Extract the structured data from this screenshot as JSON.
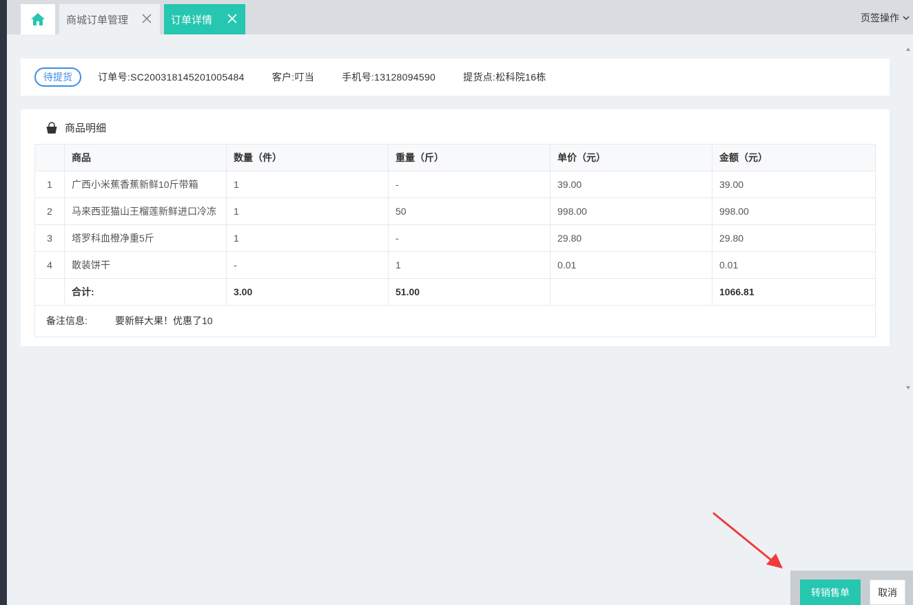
{
  "tabs": {
    "home_icon": "home-icon",
    "mall_orders": "商城订单管理",
    "order_detail": "订单详情",
    "page_ops": "页签操作"
  },
  "order": {
    "status": "待提货",
    "order_no": "订单号:SC200318145201005484",
    "customer": "客户:叮当",
    "phone": "手机号:13128094590",
    "pickup": "提货点:松科院16栋"
  },
  "goods": {
    "title": "商品明细",
    "columns": [
      "商品",
      "数量（件）",
      "重量（斤）",
      "单价（元）",
      "金额（元）"
    ],
    "rows": [
      {
        "idx": "1",
        "name": "广西小米蕉香蕉新鲜10斤带箱",
        "qty": "1",
        "weight": "-",
        "price": "39.00",
        "amount": "39.00"
      },
      {
        "idx": "2",
        "name": "马来西亚猫山王榴莲新鲜进口冷冻",
        "qty": "1",
        "weight": "50",
        "price": "998.00",
        "amount": "998.00"
      },
      {
        "idx": "3",
        "name": "塔罗科血橙净重5斤",
        "qty": "1",
        "weight": "-",
        "price": "29.80",
        "amount": "29.80"
      },
      {
        "idx": "4",
        "name": "散装饼干",
        "qty": "-",
        "weight": "1",
        "price": "0.01",
        "amount": "0.01"
      }
    ],
    "total": {
      "label": "合计:",
      "qty": "3.00",
      "weight": "51.00",
      "price": "",
      "amount": "1066.81"
    },
    "remark_label": "备注信息:",
    "remark_value": "要新鲜大果！优惠了10"
  },
  "footer": {
    "convert_label": "转销售单",
    "cancel_label": "取消"
  },
  "colors": {
    "accent": "#26c6b0",
    "status_blue": "#3a8ee6",
    "annotation_red": "#f03c3c"
  }
}
